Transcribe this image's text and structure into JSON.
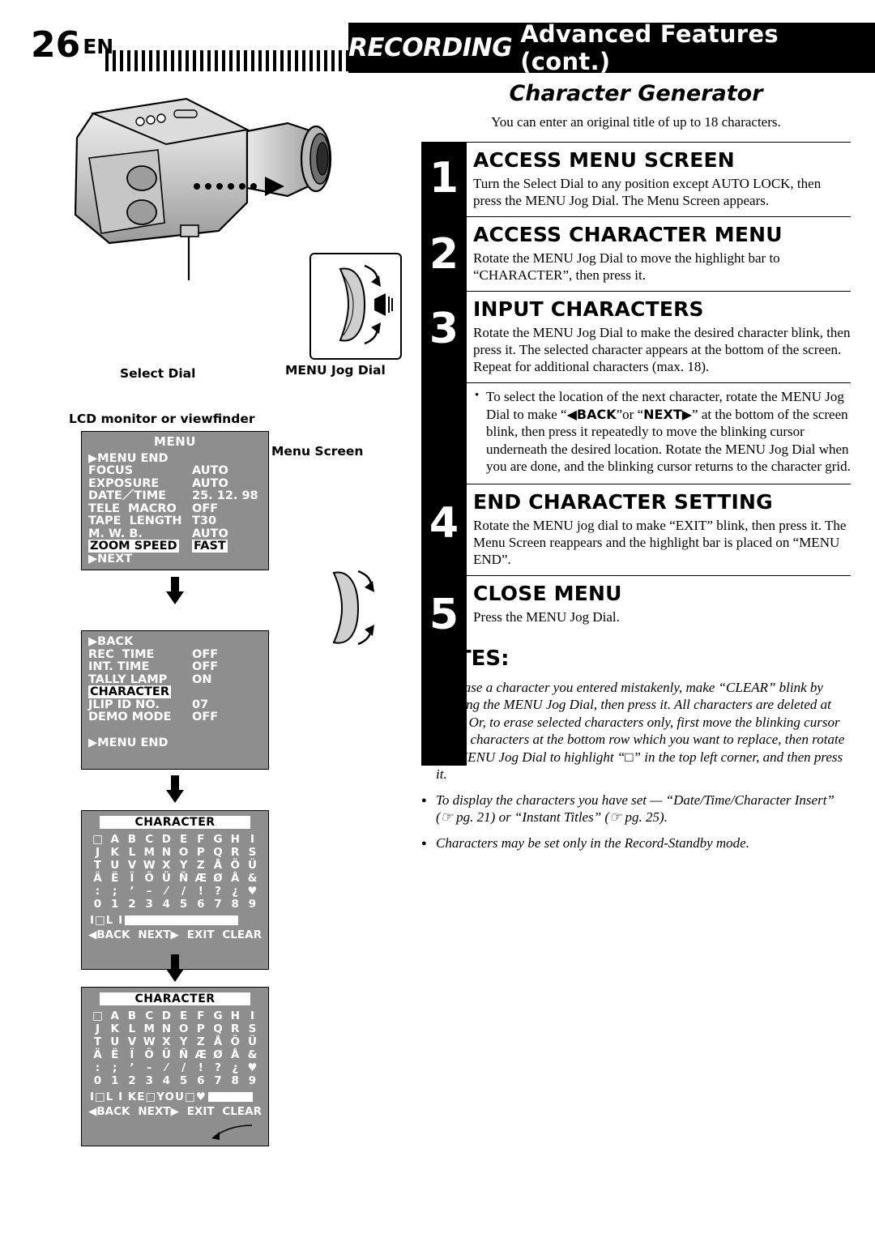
{
  "header": {
    "page_number": "26",
    "page_lang": "EN",
    "title_italic": "RECORDING",
    "title_rest": "Advanced Features (cont.)"
  },
  "left": {
    "select_dial_label": "Select Dial",
    "menu_jog_label": "MENU Jog Dial",
    "lcd_label": "LCD monitor or viewfinder",
    "menu_screen_label": "Menu Screen",
    "screen1": {
      "title": "MENU",
      "first_item": "MENU END",
      "rows": [
        {
          "k": "FOCUS",
          "v": "AUTO"
        },
        {
          "k": "EXPOSURE",
          "v": "AUTO"
        },
        {
          "k": "DATE／TIME",
          "v": "25. 12. 98"
        },
        {
          "k": "TELE  MACRO",
          "v": "OFF"
        },
        {
          "k": "TAPE  LENGTH",
          "v": "T30"
        },
        {
          "k": "M. W. B.",
          "v": "AUTO"
        },
        {
          "k": "ZOOM SPEED",
          "v": "FAST"
        }
      ],
      "highlight_key": "ZOOM SPEED",
      "highlight_value": "FAST",
      "last_item": "NEXT"
    },
    "screen2": {
      "first_item": "BACK",
      "rows": [
        {
          "k": "REC  TIME",
          "v": "OFF"
        },
        {
          "k": "INT. TIME",
          "v": "OFF"
        },
        {
          "k": "TALLY LAMP",
          "v": "ON"
        },
        {
          "k": "CHARACTER",
          "v": ""
        },
        {
          "k": "JLIP ID NO.",
          "v": "07"
        },
        {
          "k": "DEMO MODE",
          "v": "OFF"
        }
      ],
      "highlight_key": "CHARACTER",
      "last_item": "MENU END"
    },
    "char_screen_1": {
      "title": "CHARACTER",
      "rows": [
        [
          "□",
          "A",
          "B",
          "C",
          "D",
          "E",
          "F",
          "G",
          "H",
          "I"
        ],
        [
          "J",
          "K",
          "L",
          "M",
          "N",
          "O",
          "P",
          "Q",
          "R",
          "S"
        ],
        [
          "T",
          "U",
          "V",
          "W",
          "X",
          "Y",
          "Z",
          "Å",
          "Ö",
          "Ü"
        ],
        [
          "Ä",
          "Ë",
          "Ï",
          "Ö",
          "Ü",
          "Ñ",
          "Æ",
          "Ø",
          "Å",
          "&"
        ],
        [
          ":",
          ";",
          "’",
          "–",
          "⁄",
          "/",
          "!",
          "?",
          "¿",
          "♥"
        ],
        [
          "0",
          "1",
          "2",
          "3",
          "4",
          "5",
          "6",
          "7",
          "8",
          "9"
        ]
      ],
      "input_text": "I□L I",
      "input_blocks": 12,
      "footer": [
        "◀BACK",
        "NEXT▶",
        "EXIT",
        "CLEAR"
      ]
    },
    "char_screen_2": {
      "title": "CHARACTER",
      "rows": [
        [
          "□",
          "A",
          "B",
          "C",
          "D",
          "E",
          "F",
          "G",
          "H",
          "I"
        ],
        [
          "J",
          "K",
          "L",
          "M",
          "N",
          "O",
          "P",
          "Q",
          "R",
          "S"
        ],
        [
          "T",
          "U",
          "V",
          "W",
          "X",
          "Y",
          "Z",
          "Å",
          "Ö",
          "Ü"
        ],
        [
          "Ä",
          "Ë",
          "Ï",
          "Ö",
          "Ü",
          "Ñ",
          "Æ",
          "Ø",
          "Å",
          "&"
        ],
        [
          ":",
          ";",
          "’",
          "–",
          "⁄",
          "/",
          "!",
          "?",
          "¿",
          "♥"
        ],
        [
          "0",
          "1",
          "2",
          "3",
          "4",
          "5",
          "6",
          "7",
          "8",
          "9"
        ]
      ],
      "input_text": "I□L I KE□YOU□♥",
      "input_blocks": 5,
      "footer": [
        "◀BACK",
        "NEXT▶",
        "EXIT",
        "CLEAR"
      ]
    }
  },
  "right": {
    "section_title": "Character Generator",
    "section_sub": "You can enter an original title of up to 18 characters.",
    "steps": [
      {
        "num": "1",
        "head": "ACCESS MENU SCREEN",
        "text": "Turn the Select Dial to any position except AUTO LOCK, then press the MENU Jog Dial. The Menu Screen appears."
      },
      {
        "num": "2",
        "head": "ACCESS CHARACTER MENU",
        "text": "Rotate the MENU Jog Dial to move the highlight bar to “CHARACTER”, then press it."
      },
      {
        "num": "3",
        "head": "INPUT CHARACTERS",
        "text": "Rotate the MENU Jog Dial to make the desired character blink, then press it. The selected character appears at the bottom of the screen. Repeat for additional characters (max. 18)."
      },
      {
        "num": "4",
        "head": "END CHARACTER SETTING",
        "text": "Rotate the MENU jog dial to make “EXIT” blink, then press it. The Menu Screen reappears and the highlight bar is placed on “MENU END”."
      },
      {
        "num": "5",
        "head": "CLOSE MENU",
        "text": "Press the MENU Jog Dial."
      }
    ],
    "step3_bullet_a": "To select the location of the next character, rotate the MENU Jog Dial to make “",
    "step3_bullet_back": "◀BACK",
    "step3_bullet_b": "”or “",
    "step3_bullet_next": "NEXT▶",
    "step3_bullet_c": "” at the bottom of the screen blink, then press it repeatedly to move the blinking cursor underneath the desired location. Rotate the MENU Jog Dial when you are done, and the blinking cursor returns to the character grid.",
    "notes_title": "NOTES:",
    "notes": [
      "To erase a character you entered mistakenly, make “CLEAR” blink by rotating the MENU Jog Dial, then press it. All characters are deleted at once. Or, to erase selected characters only, first move the blinking cursor to the characters at the bottom row which you want to replace, then rotate the MENU Jog Dial to highlight “□” in the top left corner, and then press it.",
      "To display the characters you have set — “Date/Time/Character Insert” (☞ pg. 21) or “Instant Titles” (☞ pg. 25).",
      "Characters may be set only in the Record-Standby mode."
    ]
  }
}
